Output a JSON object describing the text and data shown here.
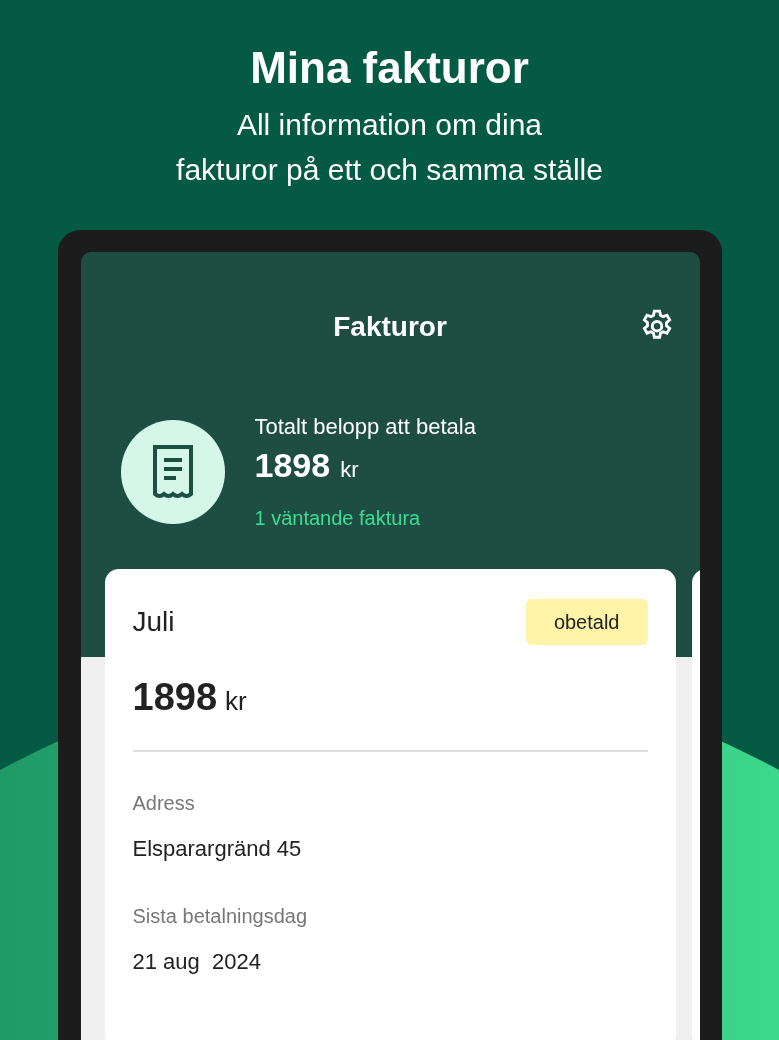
{
  "promo": {
    "title": "Mina fakturor",
    "subtitle_lines": [
      "All information om dina",
      "fakturor på ett och samma ställe"
    ]
  },
  "app_bar": {
    "title": "Fakturor"
  },
  "summary": {
    "label": "Totalt belopp att betala",
    "amount": "1898",
    "currency": "kr",
    "pending": "1 väntande faktura"
  },
  "invoices": [
    {
      "month": "Juli",
      "status": "obetald",
      "amount": "1898",
      "currency": "kr",
      "fields": [
        {
          "label": "Adress",
          "value": "Elsparargränd 45"
        },
        {
          "label": "Sista betalningsdag",
          "value": "21 aug  2024"
        }
      ]
    }
  ]
}
